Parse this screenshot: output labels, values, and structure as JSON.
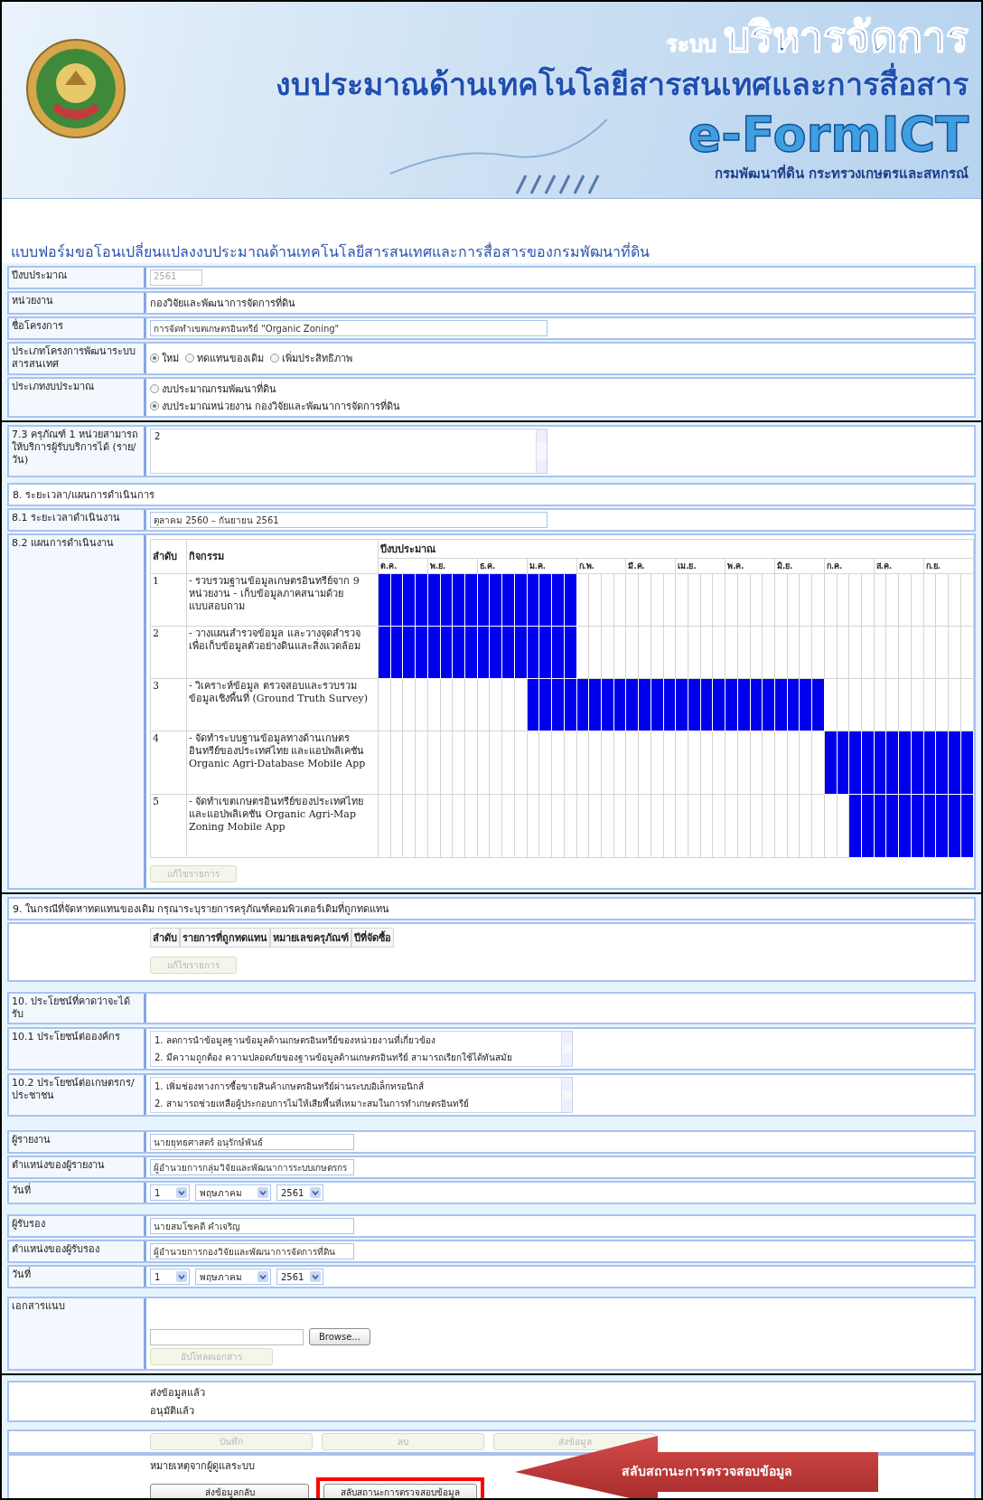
{
  "header": {
    "system_prefix": "ระบบ",
    "system_name": "บริหารจัดการ",
    "subtitle": "งบประมาณด้านเทคโนโลยีสารสนเทศและการสื่อสาร",
    "product": "e-FormICT",
    "organization": "กรมพัฒนาที่ดิน กระทรวงเกษตรและสหกรณ์"
  },
  "form_title": "แบบฟอร์มขอโอนเปลี่ยนแปลงงบประมาณด้านเทคโนโลยีสารสนเทศและการสื่อสารของกรมพัฒนาที่ดิน",
  "info_rows": [
    {
      "kind": "field",
      "label": "ปีงบประมาณ",
      "value": "2561",
      "disabled": true,
      "wide": false
    },
    {
      "kind": "text",
      "label": "หน่วยงาน",
      "value": "กองวิจัยและพัฒนาการจัดการที่ดิน"
    },
    {
      "kind": "field",
      "label": "ชื่อโครงการ",
      "value": "การจัดทำเขตเกษตรอินทรีย์ \"Organic Zoning\"",
      "disabled": false,
      "wide": true
    },
    {
      "kind": "radio_row",
      "label": "ประเภทโครงการพัฒนาระบบสารสนเทศ",
      "options": [
        {
          "label": "ใหม่",
          "selected": true
        },
        {
          "label": "ทดแทนของเดิม",
          "selected": false
        },
        {
          "label": "เพิ่มประสิทธิภาพ",
          "selected": false
        }
      ]
    },
    {
      "kind": "radio_column",
      "label": "ประเภทงบประมาณ",
      "options": [
        {
          "label": "งบประมาณกรมพัฒนาที่ดิน",
          "selected": false
        },
        {
          "label": "งบประมาณหน่วยงาน กองวิจัยและพัฒนาการจัดการที่ดิน",
          "selected": true
        }
      ]
    }
  ],
  "capacity": {
    "label": "7.3 ครุภัณฑ์ 1 หน่วยสามารถให้บริการผู้รับบริการได้ (ราย/วัน)",
    "value": "2"
  },
  "plan": {
    "heading": "8. ระยะเวลา/แผนการดำเนินการ",
    "period_label": "8.1 ระยะเวลาดำเนินงาน",
    "period_value": "ตุลาคม 2560 – กันยายน 2561",
    "schedule_label": "8.2 แผนการดำเนินงาน",
    "columns": {
      "no": "ลำดับ",
      "activity": "กิจกรรม",
      "year": "ปีงบประมาณ"
    },
    "months": [
      "ต.ค.",
      "พ.ย.",
      "ธ.ค.",
      "ม.ค.",
      "ก.พ.",
      "มี.ค.",
      "เม.ย.",
      "พ.ค.",
      "มิ.ย.",
      "ก.ค.",
      "ส.ค.",
      "ก.ย."
    ],
    "rows": [
      {
        "no": "1",
        "activity": "- รวบรวมฐานข้อมูลเกษตรอินทรีย์จาก 9 หน่วยงาน - เก็บข้อมูลภาคสนามด้วยแบบสอบถาม",
        "weeks": [
          true,
          true,
          true,
          true,
          true,
          true,
          true,
          true,
          true,
          true,
          true,
          true,
          true,
          true,
          true,
          true,
          false,
          false,
          false,
          false,
          false,
          false,
          false,
          false,
          false,
          false,
          false,
          false,
          false,
          false,
          false,
          false,
          false,
          false,
          false,
          false,
          false,
          false,
          false,
          false,
          false,
          false,
          false,
          false,
          false,
          false,
          false,
          false
        ]
      },
      {
        "no": "2",
        "activity": "- วางแผนสำรวจข้อมูล และวางจุดสำรวจเพื่อเก็บข้อมูลตัวอย่างดินและสิ่งแวดล้อม",
        "weeks": [
          true,
          true,
          true,
          true,
          true,
          true,
          true,
          true,
          true,
          true,
          true,
          true,
          true,
          true,
          true,
          true,
          false,
          false,
          false,
          false,
          false,
          false,
          false,
          false,
          false,
          false,
          false,
          false,
          false,
          false,
          false,
          false,
          false,
          false,
          false,
          false,
          false,
          false,
          false,
          false,
          false,
          false,
          false,
          false,
          false,
          false,
          false,
          false
        ]
      },
      {
        "no": "3",
        "activity": "- วิเคราะห์ข้อมูล ตรวจสอบและรวบรวมข้อมูลเชิงพื้นที่ (Ground Truth Survey)",
        "weeks": [
          false,
          false,
          false,
          false,
          false,
          false,
          false,
          false,
          false,
          false,
          false,
          false,
          true,
          true,
          true,
          true,
          true,
          true,
          true,
          true,
          true,
          true,
          true,
          true,
          true,
          true,
          true,
          true,
          true,
          true,
          true,
          true,
          true,
          true,
          true,
          true,
          false,
          false,
          false,
          false,
          false,
          false,
          false,
          false,
          false,
          false,
          false,
          false
        ]
      },
      {
        "no": "4",
        "activity": "- จัดทำระบบฐานข้อมูลทางด้านเกษตรอินทรีย์ของประเทศไทย และแอปพลิเคชัน Organic Agri-Database Mobile App",
        "weeks": [
          false,
          false,
          false,
          false,
          false,
          false,
          false,
          false,
          false,
          false,
          false,
          false,
          false,
          false,
          false,
          false,
          false,
          false,
          false,
          false,
          false,
          false,
          false,
          false,
          false,
          false,
          false,
          false,
          false,
          false,
          false,
          false,
          false,
          false,
          false,
          false,
          true,
          true,
          true,
          true,
          true,
          true,
          true,
          true,
          true,
          true,
          true,
          true
        ]
      },
      {
        "no": "5",
        "activity": "- จัดทำเขตเกษตรอินทรีย์ของประเทศไทย และแอปพลิเคชัน Organic Agri-Map Zoning Mobile App",
        "weeks": [
          false,
          false,
          false,
          false,
          false,
          false,
          false,
          false,
          false,
          false,
          false,
          false,
          false,
          false,
          false,
          false,
          false,
          false,
          false,
          false,
          false,
          false,
          false,
          false,
          false,
          false,
          false,
          false,
          false,
          false,
          false,
          false,
          false,
          false,
          false,
          false,
          false,
          false,
          true,
          true,
          true,
          true,
          true,
          true,
          true,
          true,
          true,
          true
        ]
      }
    ],
    "edit_button": {
      "label": "แก้ไขรายการ",
      "disabled": true
    }
  },
  "replacement": {
    "heading": "9. ในกรณีที่จัดหาทดแทนของเดิม กรุณาระบุรายการครุภัณฑ์คอมพิวเตอร์เดิมที่ถูกทดแทน",
    "columns": [
      "ลำดับ",
      "รายการที่ถูกทดแทน",
      "หมายเลขครุภัณฑ์",
      "ปีที่จัดซื้อ"
    ],
    "edit_button": {
      "label": "แก้ไขรายการ",
      "disabled": true
    }
  },
  "benefits": {
    "heading": "10. ประโยชน์ที่คาดว่าจะได้รับ",
    "items": [
      {
        "label": "10.1 ประโยชน์ต่อองค์กร",
        "lines": [
          "1.  ลดการนำข้อมูลฐานข้อมูลด้านเกษตรอินทรีย์ของหน่วยงานที่เกี่ยวข้อง",
          "2.  มีความถูกต้อง ความปลอดภัยของฐานข้อมูลด้านเกษตรอินทรีย์ สามารถเรียกใช้ได้ทันสมัย"
        ]
      },
      {
        "label": "10.2 ประโยชน์ต่อเกษตรกร/ประชาชน",
        "lines": [
          "1.  เพิ่มช่องทางการซื้อขายสินค้าเกษตรอินทรีย์ผ่านระบบอิเล็กทรอนิกส์",
          "2.  สามารถช่วยเหลือผู้ประกอบการไม่ให้เสียพื้นที่เหมาะสมในการทำเกษตรอินทรีย์"
        ]
      }
    ]
  },
  "signers": [
    {
      "rows": [
        {
          "kind": "field",
          "label": "ผู้รายงาน",
          "value": "นายยุทธศาสตร์ อนุรักษ์พันธ์"
        },
        {
          "kind": "field",
          "label": "ตำแหน่งของผู้รายงาน",
          "value": "ผู้อำนวยการกลุ่มวิจัยและพัฒนาการระบบเกษตรกร"
        },
        {
          "kind": "date",
          "label": "วันที่",
          "day": "1",
          "month": "พฤษภาคม",
          "year": "2561"
        }
      ]
    },
    {
      "rows": [
        {
          "kind": "field",
          "label": "ผู้รับรอง",
          "value": "นายสมโชคดี คำเจริญ"
        },
        {
          "kind": "field",
          "label": "ตำแหน่งของผู้รับรอง",
          "value": "ผู้อำนวยการกองวิจัยและพัฒนาการจัดการที่ดิน"
        },
        {
          "kind": "date",
          "label": "วันที่",
          "day": "1",
          "month": "พฤษภาคม",
          "year": "2561"
        }
      ]
    }
  ],
  "attachment": {
    "label": "เอกสารแนบ",
    "browse_button": "Browse...",
    "upload_button": {
      "label": "อัปโหลดเอกสาร",
      "disabled": true
    }
  },
  "status": {
    "lines": [
      "ส่งข้อมูลแล้ว",
      "อนุมัติแล้ว"
    ]
  },
  "actions": [
    {
      "label": "บันทึก",
      "disabled": true
    },
    {
      "label": "ลบ",
      "disabled": true
    },
    {
      "label": "ส่งข้อมูล",
      "disabled": true
    }
  ],
  "admin": {
    "note_label": "หมายเหตุจากผู้ดูแลระบบ",
    "buttons": [
      {
        "label": "ส่งข้อมูลกลับ",
        "highlighted": false
      },
      {
        "label": "สลับสถานะการตรวจสอบข้อมูล",
        "highlighted": true
      }
    ]
  },
  "callout": {
    "text": "สลับสถานะการตรวจสอบข้อมูล"
  }
}
